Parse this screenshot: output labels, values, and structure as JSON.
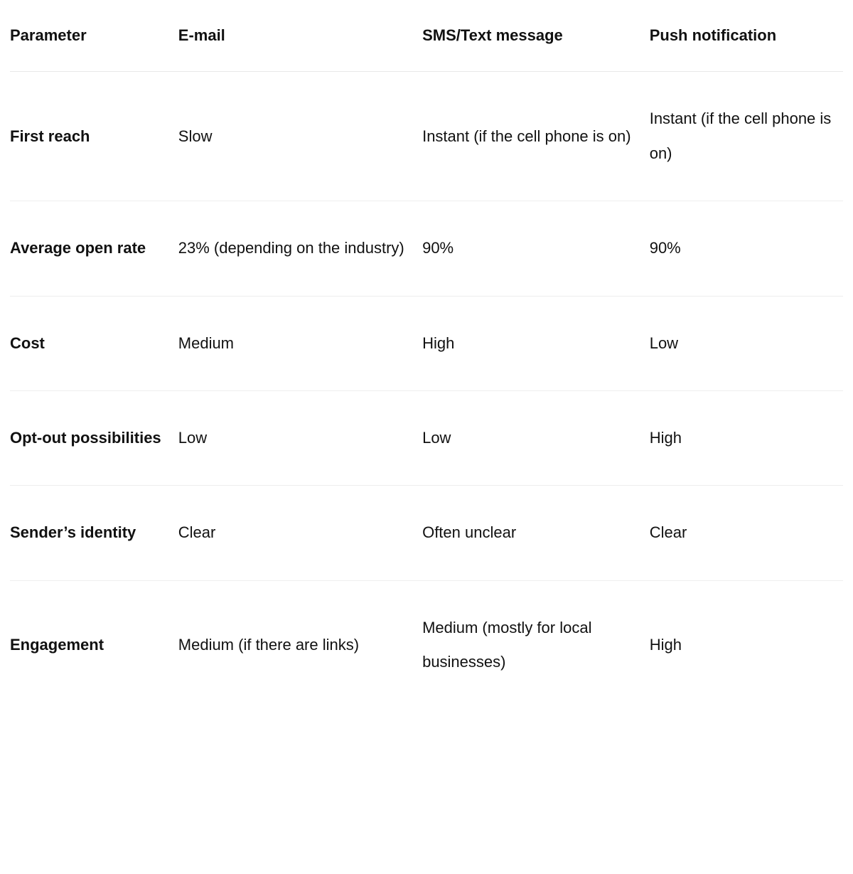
{
  "table": {
    "headers": [
      "Parameter",
      "E-mail",
      "SMS/Text message",
      "Push notification"
    ],
    "rows": [
      {
        "param": "First reach",
        "email": "Slow",
        "sms": "Instant (if the cell phone is on)",
        "push": "Instant (if the cell phone is on)"
      },
      {
        "param": "Average open rate",
        "email": "23% (depending on the industry)",
        "sms": "90%",
        "push": "90%"
      },
      {
        "param": "Cost",
        "email": "Medium",
        "sms": "High",
        "push": "Low"
      },
      {
        "param": "Opt-out possibilities",
        "email": "Low",
        "sms": "Low",
        "push": "High"
      },
      {
        "param": "Sender’s identity",
        "email": "Clear",
        "sms": "Often unclear",
        "push": "Clear"
      },
      {
        "param": "Engagement",
        "email": "Medium (if there are links)",
        "sms": "Medium (mostly for local businesses)",
        "push": "High"
      }
    ]
  },
  "chart_data": {
    "type": "table",
    "title": "",
    "columns": [
      "Parameter",
      "E-mail",
      "SMS/Text message",
      "Push notification"
    ],
    "rows": [
      [
        "First reach",
        "Slow",
        "Instant (if the cell phone is on)",
        "Instant (if the cell phone is on)"
      ],
      [
        "Average open rate",
        "23% (depending on the industry)",
        "90%",
        "90%"
      ],
      [
        "Cost",
        "Medium",
        "High",
        "Low"
      ],
      [
        "Opt-out possibilities",
        "Low",
        "Low",
        "High"
      ],
      [
        "Sender’s identity",
        "Clear",
        "Often unclear",
        "Clear"
      ],
      [
        "Engagement",
        "Medium (if there are links)",
        "Medium (mostly for local businesses)",
        "High"
      ]
    ]
  }
}
